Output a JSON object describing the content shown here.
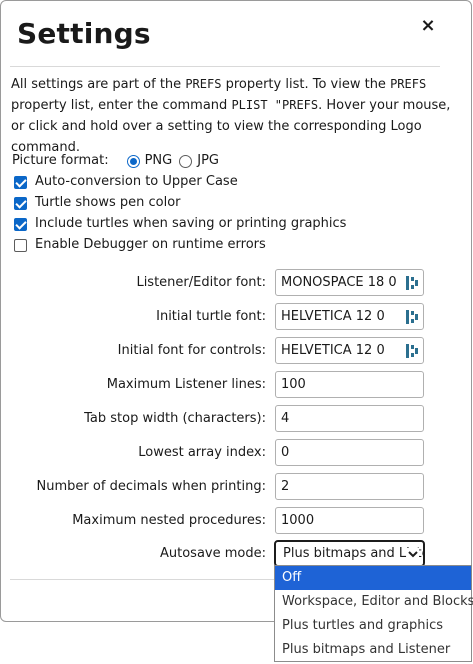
{
  "dialog": {
    "title": "Settings",
    "close_label": "×"
  },
  "intro": {
    "p1": "All settings are part of the ",
    "code1": "PREFS",
    "p2": " property list. To view the ",
    "code2": "PREFS",
    "p3": " property list, enter the command ",
    "code3": "PLIST \"PREFS",
    "p4": ". Hover your mouse, or click and hold over a setting to view the corresponding Logo command."
  },
  "picture_format": {
    "label": "Picture format:",
    "options": [
      {
        "label": "PNG",
        "selected": true
      },
      {
        "label": "JPG",
        "selected": false
      }
    ]
  },
  "checkboxes": [
    {
      "label": "Auto-conversion to Upper Case",
      "checked": true
    },
    {
      "label": "Turtle shows pen color",
      "checked": true
    },
    {
      "label": "Include turtles when saving or printing graphics",
      "checked": true
    },
    {
      "label": "Enable Debugger on runtime errors",
      "checked": false
    }
  ],
  "fields": {
    "listener_font": {
      "label": "Listener/Editor font:",
      "value": "MONOSPACE 18 0"
    },
    "turtle_font": {
      "label": "Initial turtle font:",
      "value": "HELVETICA 12 0"
    },
    "controls_font": {
      "label": "Initial font for controls:",
      "value": "HELVETICA 12 0"
    },
    "max_listener_lines": {
      "label": "Maximum Listener lines:",
      "value": "100"
    },
    "tab_stop": {
      "label": "Tab stop width (characters):",
      "value": "4"
    },
    "lowest_array_index": {
      "label": "Lowest array index:",
      "value": "0"
    },
    "decimals": {
      "label": "Number of decimals when printing:",
      "value": "2"
    },
    "max_nested": {
      "label": "Maximum nested procedures:",
      "value": "1000"
    }
  },
  "autosave": {
    "label": "Autosave mode:",
    "current": "Plus bitmaps and Listener",
    "options": [
      {
        "label": "Off",
        "highlighted": true
      },
      {
        "label": "Workspace, Editor and Blocks",
        "highlighted": false
      },
      {
        "label": "Plus turtles and graphics",
        "highlighted": false
      },
      {
        "label": "Plus bitmaps and Listener",
        "highlighted": false
      }
    ]
  },
  "colors": {
    "accent": "#0b67c8",
    "highlight": "#1e63d6"
  },
  "icons": {
    "font_picker": "font-picker-icon",
    "close": "close-icon",
    "select": "chevron-down-icon"
  }
}
